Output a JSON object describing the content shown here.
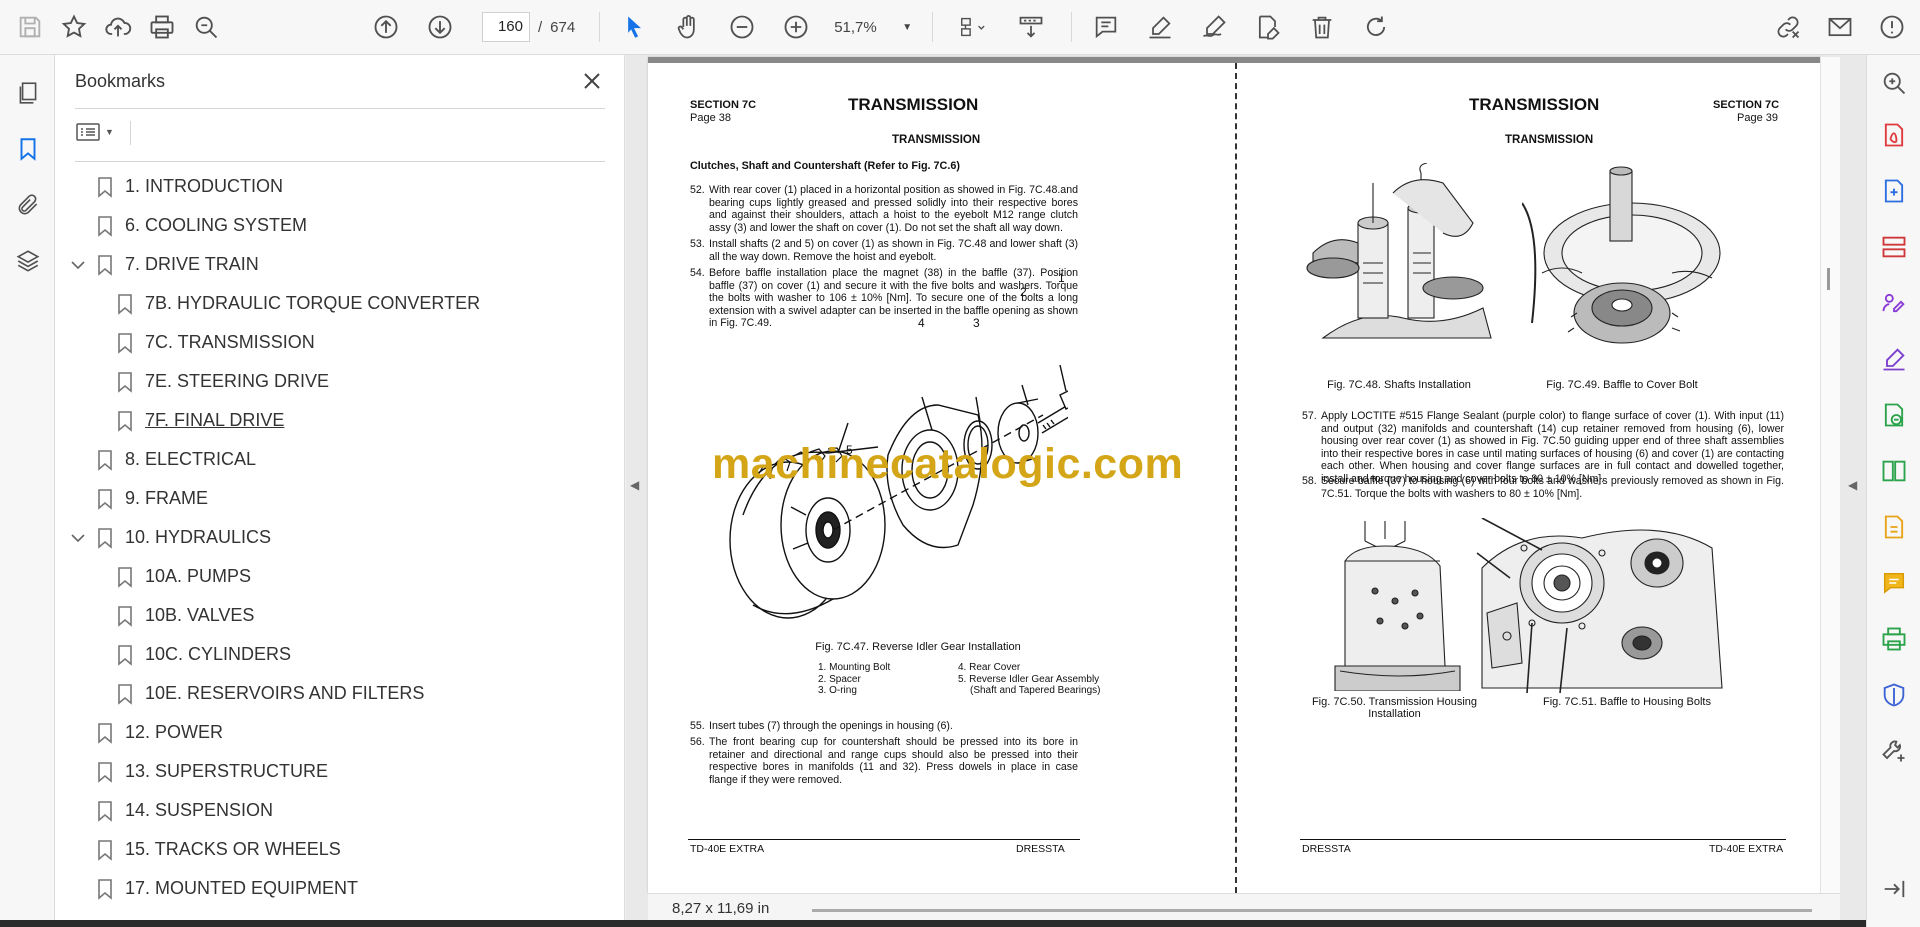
{
  "toolbar": {
    "page_current": "160",
    "page_separator": "/",
    "page_total": "674",
    "zoom": "51,7%"
  },
  "bookmarks": {
    "title": "Bookmarks",
    "items": [
      {
        "label": "1. INTRODUCTION"
      },
      {
        "label": "6. COOLING SYSTEM"
      },
      {
        "label": "7. DRIVE TRAIN"
      },
      {
        "label": "7B. HYDRAULIC TORQUE CONVERTER"
      },
      {
        "label": "7C. TRANSMISSION"
      },
      {
        "label": "7E. STEERING DRIVE"
      },
      {
        "label": "7F. FINAL DRIVE"
      },
      {
        "label": "8. ELECTRICAL"
      },
      {
        "label": "9. FRAME"
      },
      {
        "label": "10. HYDRAULICS"
      },
      {
        "label": "10A. PUMPS"
      },
      {
        "label": "10B. VALVES"
      },
      {
        "label": "10C. CYLINDERS"
      },
      {
        "label": "10E. RESERVOIRS AND FILTERS"
      },
      {
        "label": "12. POWER"
      },
      {
        "label": "13. SUPERSTRUCTURE"
      },
      {
        "label": "14. SUSPENSION"
      },
      {
        "label": "15. TRACKS OR WHEELS"
      },
      {
        "label": "17. MOUNTED EQUIPMENT"
      }
    ]
  },
  "left_page": {
    "section": "SECTION 7C",
    "page": "Page 38",
    "title": "TRANSMISSION",
    "subtitle": "TRANSMISSION",
    "heading": "Clutches, Shaft and Countershaft (Refer to Fig. 7C.6)",
    "para52_n": "52.",
    "para52": "With rear cover (1) placed in a horizontal position as showed in Fig. 7C.48.and bearing cups lightly greased and pressed solidly into their respective bores and against their shoulders, attach a hoist to the eyebolt M12 range clutch assy (3) and lower the shaft on cover (1). Do not set the shaft all way down.",
    "para53_n": "53.",
    "para53": "Install shafts (2 and 5) on cover (1) as shown in Fig. 7C.48 and lower shaft (3) all the way down. Remove the hoist and eyebolt.",
    "para54_n": "54.",
    "para54": "Before baffle installation place the magnet (38) in the baffle (37). Position baffle (37) on cover (1) and secure it with the five bolts and washers. Torque the bolts with washer to 106 ± 10% [Nm]. To secure one of the bolts a long extension with a swivel adapter can be inserted in the baffle opening as shown in Fig. 7C.49.",
    "callouts": [
      "1",
      "2",
      "3",
      "4",
      "5"
    ],
    "fig_caption": "Fig. 7C.47. Reverse Idler Gear Installation",
    "legend_left": [
      "1. Mounting Bolt",
      "2. Spacer",
      "3. O-ring"
    ],
    "legend_right": [
      "4. Rear Cover",
      "5. Reverse Idler Gear Assembly",
      "(Shaft and Tapered Bearings)"
    ],
    "para55_n": "55.",
    "para55": "Insert tubes (7) through the openings in housing (6).",
    "para56_n": "56.",
    "para56": "The front bearing cup for countershaft should be pressed into its bore in retainer and directional and range cups should also be pressed into their respective bores in manifolds (11 and 32). Press dowels in place in case flange if they were removed.",
    "footer_left": "TD-40E EXTRA",
    "footer_right": "DRESSTA"
  },
  "right_page": {
    "title": "TRANSMISSION",
    "section": "SECTION 7C",
    "page": "Page 39",
    "subtitle": "TRANSMISSION",
    "fig48": "Fig. 7C.48. Shafts Installation",
    "fig49": "Fig. 7C.49. Baffle to Cover Bolt",
    "para57_n": "57.",
    "para57": "Apply LOCTITE #515 Flange Sealant (purple color) to flange surface of cover (1). With input (11) and output (32) manifolds and countershaft (14) cup retainer removed from housing (6), lower housing over rear cover (1) as showed in Fig. 7C.50 guiding upper end of three shaft assemblies into their respective bores in case until mating surfaces of housing (6) and cover (1) are contacting each other. When housing and cover flange surfaces are in full contact and dowelled together, install and torque housing and cover bolts to 80 ± 10% [Nm].",
    "para58_n": "58.",
    "para58": "Secure baffle (37) to housing (6) with four bolts and washers previously removed as shown in Fig. 7C.51. Torque the bolts with washers to 80 ± 10% [Nm].",
    "fig50": "Fig. 7C.50. Transmission Housing Installation",
    "fig51": "Fig. 7C.51. Baffle to Housing Bolts",
    "footer_left": "DRESSTA",
    "footer_right": "TD-40E EXTRA"
  },
  "watermark": "machinecatalogic.com",
  "status": {
    "page_size": "8,27 x 11,69 in"
  },
  "colors": {
    "accent": "#1473e6",
    "watermark": "#d4a617"
  }
}
